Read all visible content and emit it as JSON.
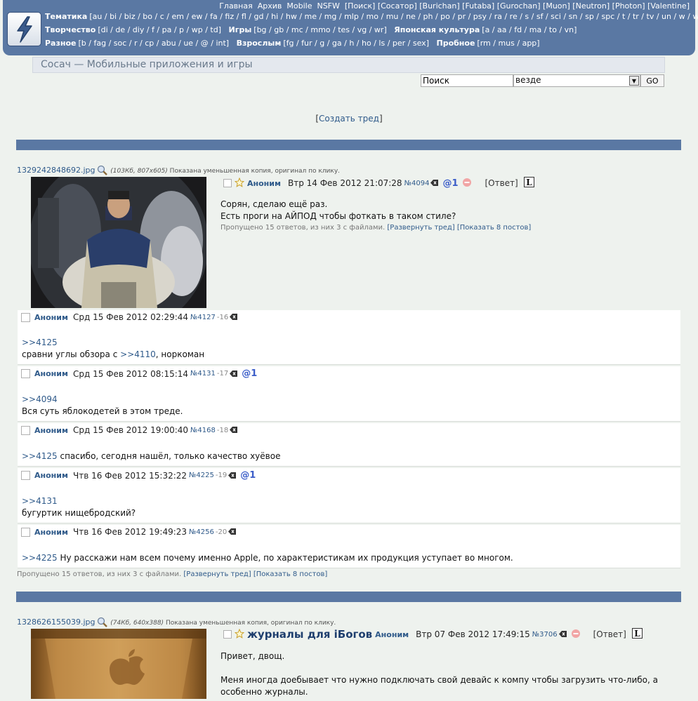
{
  "nav": {
    "top_links": [
      "Главная",
      "Архив",
      "Mobile",
      "NSFW"
    ],
    "top_brackets": [
      "[Поиск]",
      "[Сосатор]",
      "[Burichan]",
      "[Futaba]",
      "[Gurochan]",
      "[Muon]",
      "[Neutron]",
      "[Photon]",
      "[Valentine]"
    ],
    "rows": [
      [
        {
          "label": "Тематика",
          "boards": "[au / bi / biz / bo / c / em / ew / fa / fiz / fl / gd / hi / hw / me / mg / mlp / mo / mu / ne / ph / po / pr / psy / ra / re / s / sf / sci / sn / sp / spc / t / tr / tv / un / w / wh / wm]"
        }
      ],
      [
        {
          "label": "Творчество",
          "boards": "[di / de / diy / f / pa / p / wp / td]"
        },
        {
          "label": "Игры",
          "boards": "[bg / gb / mc / mmo / tes / vg / wr]"
        },
        {
          "label": "Японская культура",
          "boards": "[a / aa / fd / ma / to / vn]"
        }
      ],
      [
        {
          "label": "Разное",
          "boards": "[b / fag / soc / r / cp / abu / ue / @ / int]"
        },
        {
          "label": "Взрослым",
          "boards": "[fg / fur / g / ga / h / ho / ls / per / sex]"
        },
        {
          "label": "Пробное",
          "boards": "[rm / mus / app]"
        }
      ]
    ]
  },
  "board": {
    "title": "Сосач — Мобильные приложения и игры"
  },
  "search": {
    "value": "Поиск",
    "scope": "везде",
    "go_label": "GO"
  },
  "create_thread": {
    "open": "[",
    "label": "Создать тред",
    "close": "]"
  },
  "thread1": {
    "file": {
      "name": "1329242848692.jpg",
      "meta": "(103Кб, 807x605)",
      "note": "Показана уменьшенная копия, оригинал по клику."
    },
    "op": {
      "name": "Аноним",
      "date": "Втр 14 Фев 2012 21:07:28",
      "num": "№4094",
      "mention": "@1",
      "reply": "[Ответ]",
      "lines": [
        "Сорян, сделаю ещё раз.",
        "Есть проги на АЙПОД чтобы фоткать в таком стиле?"
      ]
    },
    "omitted": {
      "text": "Пропущено 15 ответов, из них 3 с файлами.",
      "expand": "[Развернуть тред]",
      "show": "[Показать 8 постов]"
    },
    "replies": [
      {
        "name": "Аноним",
        "date": "Срд 15 Фев 2012 02:29:44",
        "num": "№4127",
        "bump": "-16",
        "mention": "",
        "lines": [
          {
            "quote": ">>4125",
            "text": ""
          },
          {
            "quote": "",
            "text": "сравни углы обзора с ",
            "quote2": ">>4110",
            "text2": ", норкоман"
          }
        ]
      },
      {
        "name": "Аноним",
        "date": "Срд 15 Фев 2012 08:15:14",
        "num": "№4131",
        "bump": "-17",
        "mention": "@1",
        "lines": [
          {
            "quote": ">>4094",
            "text": ""
          },
          {
            "quote": "",
            "text": "Вся суть яблокодетей в этом треде."
          }
        ]
      },
      {
        "name": "Аноним",
        "date": "Срд 15 Фев 2012 19:00:40",
        "num": "№4168",
        "bump": "-18",
        "mention": "",
        "lines": [
          {
            "quote": ">>4125",
            "text": " спасибо, сегодня нашёл, только качество хуёвое"
          }
        ]
      },
      {
        "name": "Аноним",
        "date": "Чтв 16 Фев 2012 15:32:22",
        "num": "№4225",
        "bump": "-19",
        "mention": "@1",
        "lines": [
          {
            "quote": ">>4131",
            "text": ""
          },
          {
            "quote": "",
            "text": "бугуртик нищебродский?"
          }
        ]
      },
      {
        "name": "Аноним",
        "date": "Чтв 16 Фев 2012 19:49:23",
        "num": "№4256",
        "bump": "-20",
        "mention": "",
        "lines": [
          {
            "quote": ">>4225",
            "text": " Ну расскажи нам всем почему именно Apple, по характеристикам их продукция уступает во многом."
          }
        ]
      }
    ],
    "omitted_bottom": {
      "text": "Пропущено 15 ответов, из них 3 с файлами.",
      "expand": "[Развернуть тред]",
      "show": "[Показать 8 постов]"
    }
  },
  "thread2": {
    "file": {
      "name": "1328626155039.jpg",
      "meta": "(74Кб, 640x388)",
      "note": "Показана уменьшенная копия, оригинал по клику."
    },
    "op": {
      "subject": "журналы для iБогов",
      "name": "Аноним",
      "date": "Втр 07 Фев 2012 17:49:15",
      "num": "№3706",
      "reply": "[Ответ]",
      "lines": [
        "Привет, двощ.",
        "",
        "Меня иногда доебывает что нужно подключать свой девайс к компу чтобы загрузить что-либо, а",
        "особенно журналы."
      ]
    }
  },
  "colors": {
    "panel": "#5a78a3",
    "link": "#2f5a8a",
    "background": "#eef2ee"
  }
}
